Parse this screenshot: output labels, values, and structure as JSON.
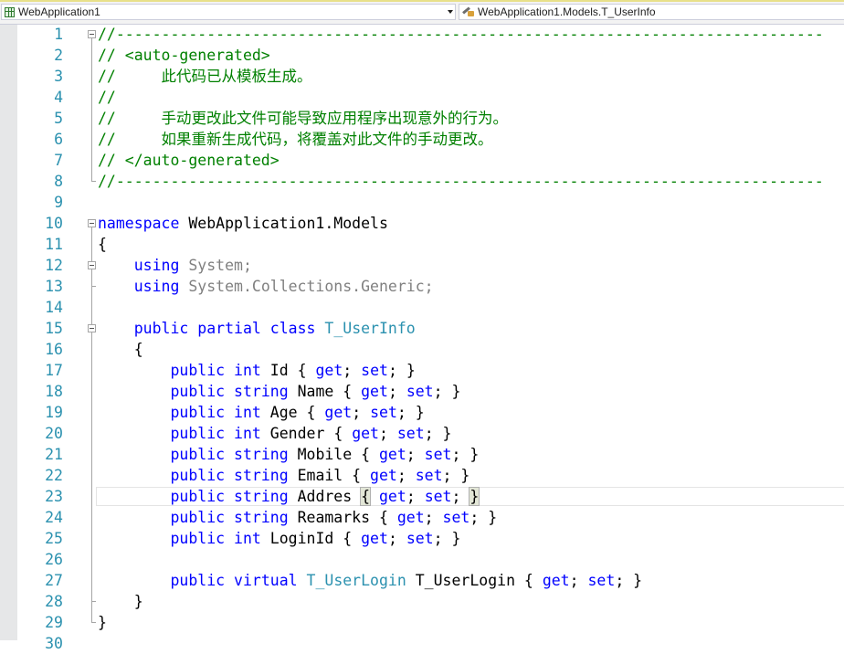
{
  "navbar": {
    "project": {
      "label": "WebApplication1",
      "icon": "csharp-project-icon"
    },
    "member": {
      "label": "WebApplication1.Models.T_UserInfo",
      "icon": "class-member-icon"
    }
  },
  "editor": {
    "current_line": 23,
    "lines": [
      {
        "n": "1",
        "tokens": [
          {
            "t": "//------------------------------------------------------------------------------",
            "c": "c"
          }
        ]
      },
      {
        "n": "2",
        "tokens": [
          {
            "t": "// <auto-generated>",
            "c": "c"
          }
        ]
      },
      {
        "n": "3",
        "tokens": [
          {
            "t": "//     此代码已从模板生成。",
            "c": "c"
          }
        ]
      },
      {
        "n": "4",
        "tokens": [
          {
            "t": "//",
            "c": "c"
          }
        ]
      },
      {
        "n": "5",
        "tokens": [
          {
            "t": "//     手动更改此文件可能导致应用程序出现意外的行为。",
            "c": "c"
          }
        ]
      },
      {
        "n": "6",
        "tokens": [
          {
            "t": "//     如果重新生成代码，将覆盖对此文件的手动更改。",
            "c": "c"
          }
        ]
      },
      {
        "n": "7",
        "tokens": [
          {
            "t": "// </auto-generated>",
            "c": "c"
          }
        ]
      },
      {
        "n": "8",
        "tokens": [
          {
            "t": "//------------------------------------------------------------------------------",
            "c": "c"
          }
        ]
      },
      {
        "n": "9",
        "tokens": []
      },
      {
        "n": "10",
        "tokens": [
          {
            "t": "namespace",
            "c": "k"
          },
          {
            "t": " WebApplication1.Models",
            "c": ""
          }
        ]
      },
      {
        "n": "11",
        "tokens": [
          {
            "t": "{",
            "c": ""
          }
        ]
      },
      {
        "n": "12",
        "tokens": [
          {
            "t": "    ",
            "c": ""
          },
          {
            "t": "using",
            "c": "k"
          },
          {
            "t": " System;",
            "c": "g"
          }
        ]
      },
      {
        "n": "13",
        "tokens": [
          {
            "t": "    ",
            "c": ""
          },
          {
            "t": "using",
            "c": "k"
          },
          {
            "t": " System.Collections.Generic;",
            "c": "g"
          }
        ]
      },
      {
        "n": "14",
        "tokens": []
      },
      {
        "n": "15",
        "tokens": [
          {
            "t": "    ",
            "c": ""
          },
          {
            "t": "public",
            "c": "k"
          },
          {
            "t": " ",
            "c": ""
          },
          {
            "t": "partial",
            "c": "k"
          },
          {
            "t": " ",
            "c": ""
          },
          {
            "t": "class",
            "c": "k"
          },
          {
            "t": " ",
            "c": ""
          },
          {
            "t": "T_UserInfo",
            "c": "t"
          }
        ]
      },
      {
        "n": "16",
        "tokens": [
          {
            "t": "    {",
            "c": ""
          }
        ]
      },
      {
        "n": "17",
        "tokens": [
          {
            "t": "        ",
            "c": ""
          },
          {
            "t": "public",
            "c": "k"
          },
          {
            "t": " ",
            "c": ""
          },
          {
            "t": "int",
            "c": "k"
          },
          {
            "t": " Id { ",
            "c": ""
          },
          {
            "t": "get",
            "c": "k"
          },
          {
            "t": "; ",
            "c": ""
          },
          {
            "t": "set",
            "c": "k"
          },
          {
            "t": "; }",
            "c": ""
          }
        ]
      },
      {
        "n": "18",
        "tokens": [
          {
            "t": "        ",
            "c": ""
          },
          {
            "t": "public",
            "c": "k"
          },
          {
            "t": " ",
            "c": ""
          },
          {
            "t": "string",
            "c": "k"
          },
          {
            "t": " Name { ",
            "c": ""
          },
          {
            "t": "get",
            "c": "k"
          },
          {
            "t": "; ",
            "c": ""
          },
          {
            "t": "set",
            "c": "k"
          },
          {
            "t": "; }",
            "c": ""
          }
        ]
      },
      {
        "n": "19",
        "tokens": [
          {
            "t": "        ",
            "c": ""
          },
          {
            "t": "public",
            "c": "k"
          },
          {
            "t": " ",
            "c": ""
          },
          {
            "t": "int",
            "c": "k"
          },
          {
            "t": " Age { ",
            "c": ""
          },
          {
            "t": "get",
            "c": "k"
          },
          {
            "t": "; ",
            "c": ""
          },
          {
            "t": "set",
            "c": "k"
          },
          {
            "t": "; }",
            "c": ""
          }
        ]
      },
      {
        "n": "20",
        "tokens": [
          {
            "t": "        ",
            "c": ""
          },
          {
            "t": "public",
            "c": "k"
          },
          {
            "t": " ",
            "c": ""
          },
          {
            "t": "int",
            "c": "k"
          },
          {
            "t": " Gender { ",
            "c": ""
          },
          {
            "t": "get",
            "c": "k"
          },
          {
            "t": "; ",
            "c": ""
          },
          {
            "t": "set",
            "c": "k"
          },
          {
            "t": "; }",
            "c": ""
          }
        ]
      },
      {
        "n": "21",
        "tokens": [
          {
            "t": "        ",
            "c": ""
          },
          {
            "t": "public",
            "c": "k"
          },
          {
            "t": " ",
            "c": ""
          },
          {
            "t": "string",
            "c": "k"
          },
          {
            "t": " Mobile { ",
            "c": ""
          },
          {
            "t": "get",
            "c": "k"
          },
          {
            "t": "; ",
            "c": ""
          },
          {
            "t": "set",
            "c": "k"
          },
          {
            "t": "; }",
            "c": ""
          }
        ]
      },
      {
        "n": "22",
        "tokens": [
          {
            "t": "        ",
            "c": ""
          },
          {
            "t": "public",
            "c": "k"
          },
          {
            "t": " ",
            "c": ""
          },
          {
            "t": "string",
            "c": "k"
          },
          {
            "t": " Email { ",
            "c": ""
          },
          {
            "t": "get",
            "c": "k"
          },
          {
            "t": "; ",
            "c": ""
          },
          {
            "t": "set",
            "c": "k"
          },
          {
            "t": "; }",
            "c": ""
          }
        ]
      },
      {
        "n": "23",
        "tokens": [
          {
            "t": "        ",
            "c": ""
          },
          {
            "t": "public",
            "c": "k"
          },
          {
            "t": " ",
            "c": ""
          },
          {
            "t": "string",
            "c": "k"
          },
          {
            "t": " Addres ",
            "c": ""
          },
          {
            "t": "{",
            "c": "bh"
          },
          {
            "t": " ",
            "c": ""
          },
          {
            "t": "get",
            "c": "k"
          },
          {
            "t": "; ",
            "c": ""
          },
          {
            "t": "set",
            "c": "k"
          },
          {
            "t": "; ",
            "c": ""
          },
          {
            "t": "}",
            "c": "bh"
          }
        ]
      },
      {
        "n": "24",
        "tokens": [
          {
            "t": "        ",
            "c": ""
          },
          {
            "t": "public",
            "c": "k"
          },
          {
            "t": " ",
            "c": ""
          },
          {
            "t": "string",
            "c": "k"
          },
          {
            "t": " Reamarks { ",
            "c": ""
          },
          {
            "t": "get",
            "c": "k"
          },
          {
            "t": "; ",
            "c": ""
          },
          {
            "t": "set",
            "c": "k"
          },
          {
            "t": "; }",
            "c": ""
          }
        ]
      },
      {
        "n": "25",
        "tokens": [
          {
            "t": "        ",
            "c": ""
          },
          {
            "t": "public",
            "c": "k"
          },
          {
            "t": " ",
            "c": ""
          },
          {
            "t": "int",
            "c": "k"
          },
          {
            "t": " LoginId { ",
            "c": ""
          },
          {
            "t": "get",
            "c": "k"
          },
          {
            "t": "; ",
            "c": ""
          },
          {
            "t": "set",
            "c": "k"
          },
          {
            "t": "; }",
            "c": ""
          }
        ]
      },
      {
        "n": "26",
        "tokens": []
      },
      {
        "n": "27",
        "tokens": [
          {
            "t": "        ",
            "c": ""
          },
          {
            "t": "public",
            "c": "k"
          },
          {
            "t": " ",
            "c": ""
          },
          {
            "t": "virtual",
            "c": "k"
          },
          {
            "t": " ",
            "c": ""
          },
          {
            "t": "T_UserLogin",
            "c": "t"
          },
          {
            "t": " T_UserLogin { ",
            "c": ""
          },
          {
            "t": "get",
            "c": "k"
          },
          {
            "t": "; ",
            "c": ""
          },
          {
            "t": "set",
            "c": "k"
          },
          {
            "t": "; }",
            "c": ""
          }
        ]
      },
      {
        "n": "28",
        "tokens": [
          {
            "t": "    }",
            "c": ""
          }
        ]
      },
      {
        "n": "29",
        "tokens": [
          {
            "t": "}",
            "c": ""
          }
        ]
      },
      {
        "n": "30",
        "tokens": []
      }
    ]
  }
}
